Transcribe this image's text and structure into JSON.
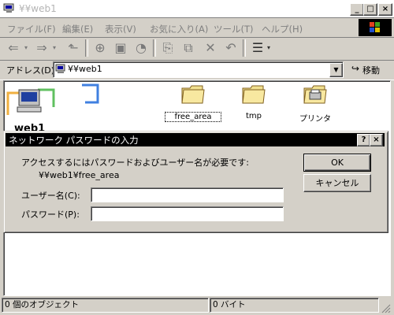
{
  "window": {
    "title": "¥¥web1"
  },
  "menu": {
    "items": [
      "ファイル(F)",
      "編集(E)",
      "表示(V)",
      "お気に入り(A)",
      "ツール(T)",
      "ヘルプ(H)"
    ]
  },
  "address": {
    "label": "アドレス(D)",
    "value": "¥¥web1",
    "go_label": "移動"
  },
  "folders": [
    {
      "label": "free_area"
    },
    {
      "label": "tmp"
    },
    {
      "label": "プリンタ"
    }
  ],
  "folder_title": "web1",
  "dialog": {
    "title": "ネットワーク パスワードの入力",
    "prompt": "アクセスするにはパスワードおよびユーザー名が必要です:",
    "resource": "¥¥web1¥free_area",
    "username_label": "ユーザー名(C):",
    "password_label": "パスワード(P):",
    "username_value": "",
    "password_value": "",
    "ok_label": "OK",
    "cancel_label": "キャンセル"
  },
  "status": {
    "objects": "0 個のオブジェクト",
    "size": "0 バイト"
  }
}
